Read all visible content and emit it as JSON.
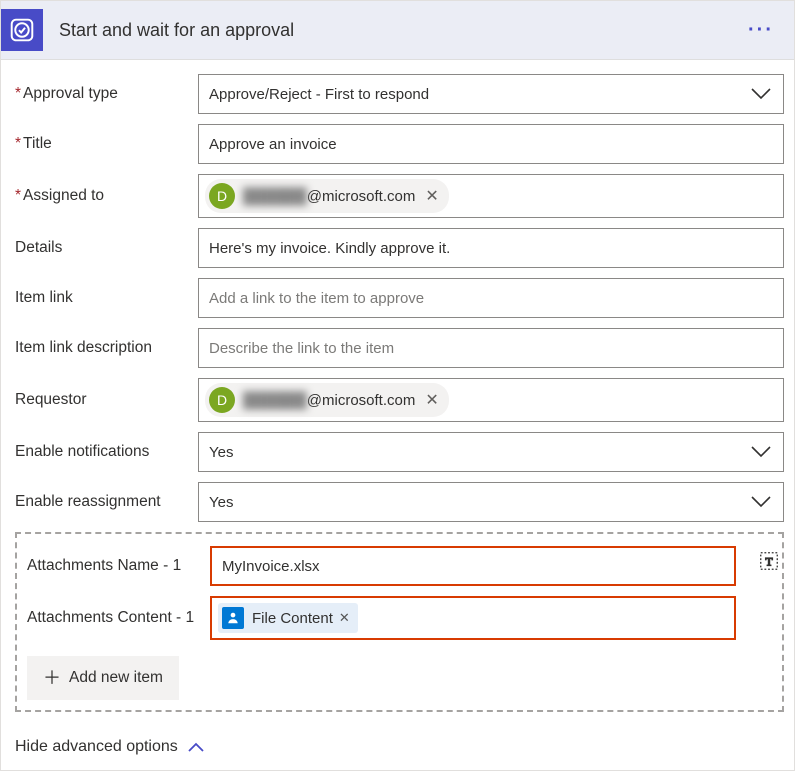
{
  "header": {
    "title": "Start and wait for an approval"
  },
  "labels": {
    "approvalType": "Approval type",
    "title": "Title",
    "assignedTo": "Assigned to",
    "details": "Details",
    "itemLink": "Item link",
    "itemLinkDesc": "Item link description",
    "requestor": "Requestor",
    "enableNotifications": "Enable notifications",
    "enableReassignment": "Enable reassignment",
    "attachName": "Attachments Name - 1",
    "attachContent": "Attachments Content - 1",
    "addNewItem": "Add new item",
    "hideAdvanced": "Hide advanced options"
  },
  "values": {
    "approvalType": "Approve/Reject - First to respond",
    "title": "Approve an invoice",
    "details": "Here's my invoice. Kindly approve it.",
    "enableNotifications": "Yes",
    "enableReassignment": "Yes",
    "attachName": "MyInvoice.xlsx"
  },
  "placeholders": {
    "itemLink": "Add a link to the item to approve",
    "itemLinkDesc": "Describe the link to the item"
  },
  "people": {
    "assignedTo": {
      "initial": "D",
      "domain": "@microsoft.com"
    },
    "requestor": {
      "initial": "D",
      "domain": "@microsoft.com"
    }
  },
  "tokens": {
    "fileContent": "File Content"
  }
}
